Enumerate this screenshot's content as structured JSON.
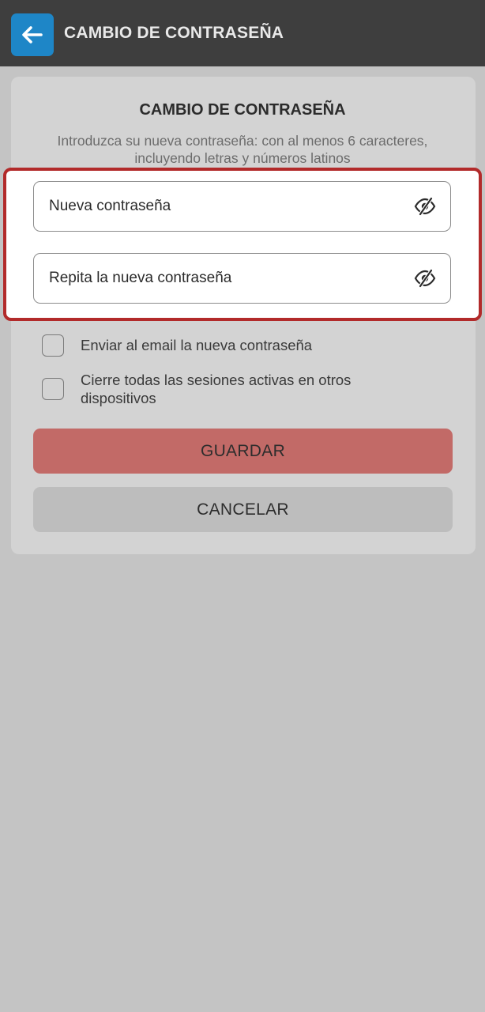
{
  "header": {
    "title": "CAMBIO DE CONTRASEÑA",
    "back_icon": "arrow-left-icon"
  },
  "form": {
    "title": "CAMBIO DE CONTRASEÑA",
    "description": "Introduzca su nueva contraseña: con al menos 6 caracteres, incluyendo letras y números latinos",
    "new_password": {
      "placeholder": "Nueva contraseña",
      "value": "",
      "icon": "eye-slash-icon"
    },
    "repeat_password": {
      "placeholder": "Repita la nueva contraseña",
      "value": "",
      "icon": "eye-slash-icon"
    },
    "options": [
      {
        "label": "Enviar al email la nueva contraseña",
        "checked": false
      },
      {
        "label": "Cierre todas las sesiones activas en otros dispositivos",
        "checked": false
      }
    ],
    "save_label": "GUARDAR",
    "cancel_label": "CANCELAR"
  },
  "colors": {
    "topbar": "#3e3e3e",
    "back_button": "#1e86c7",
    "save_button": "#c26a67",
    "cancel_button": "#bdbdbd",
    "highlight_border": "#b22a2a"
  }
}
